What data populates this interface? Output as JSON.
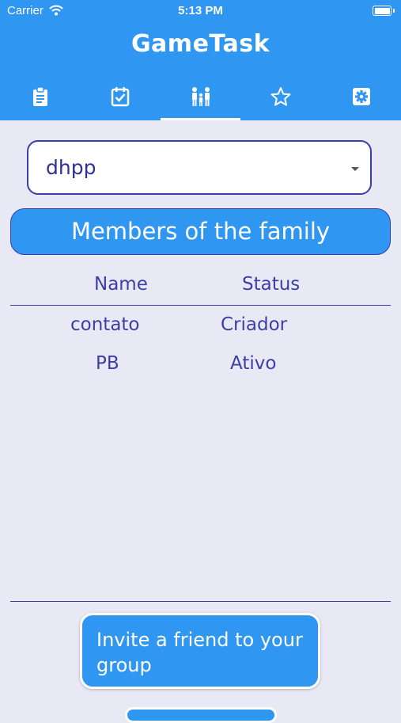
{
  "status_bar": {
    "carrier": "Carrier",
    "time": "5:13 PM"
  },
  "app": {
    "title": "GameTask"
  },
  "tabs": [
    {
      "icon": "clipboard-icon",
      "active": false
    },
    {
      "icon": "checkbox-icon",
      "active": false
    },
    {
      "icon": "family-icon",
      "active": true
    },
    {
      "icon": "star-icon",
      "active": false
    },
    {
      "icon": "gear-icon",
      "active": false
    }
  ],
  "family_select": {
    "selected": "dhpp"
  },
  "members": {
    "heading": "Members of the family",
    "columns": {
      "name": "Name",
      "status": "Status"
    },
    "rows": [
      {
        "name": "contato",
        "status": "Criador"
      },
      {
        "name": "PB",
        "status": "Ativo"
      }
    ]
  },
  "invite_button": {
    "label": "Invite a friend to your group"
  },
  "colors": {
    "primary": "#2f97f1",
    "accent": "#3b3ea6",
    "background": "#e8e9f5"
  }
}
